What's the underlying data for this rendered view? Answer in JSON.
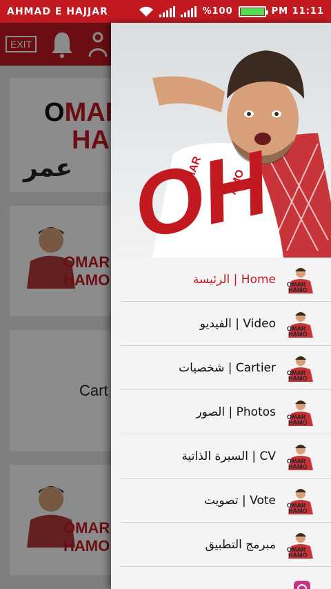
{
  "status_bar": {
    "carrier": "AHMAD E HAJJAR",
    "battery": "%100",
    "battery_level": 1.0,
    "time": "PM 11:11"
  },
  "background_app": {
    "exit_label": "EXIT",
    "logo_latin_line1_dark": "O",
    "logo_latin_line1_red": "MAR",
    "logo_latin_line2": "HA",
    "logo_arabic": "عمر حمو",
    "card_name_line1": "OMAR",
    "card_name_line2": "HAMO",
    "card_partial_text": "Cart"
  },
  "drawer": {
    "hero_logo": "OH",
    "hero_logo_sub1": "MAR",
    "hero_logo_sub2": "AMO",
    "menu_items": [
      {
        "label": "الرئيسة | Home",
        "icon": "omar-hamo-thumb-icon",
        "active": true
      },
      {
        "label": "الفيديو | Video",
        "icon": "omar-hamo-thumb-icon",
        "active": false
      },
      {
        "label": "شخصيات | Cartier",
        "icon": "omar-hamo-thumb-icon",
        "active": false
      },
      {
        "label": "الصور | Photos",
        "icon": "omar-hamo-thumb-icon",
        "active": false
      },
      {
        "label": "السيرة الذاتية | CV",
        "icon": "omar-hamo-thumb-icon",
        "active": false
      },
      {
        "label": "تصويت | Vote",
        "icon": "omar-hamo-thumb-icon",
        "active": false
      },
      {
        "label": "مبرمج التطبيق",
        "icon": "omar-hamo-thumb-icon",
        "active": false
      },
      {
        "label": "",
        "icon": "instagram-icon",
        "active": false
      }
    ],
    "thumb_text_line1": "OMAR",
    "thumb_text_line2": "HAMO"
  },
  "colors": {
    "brand_red": "#c31a22",
    "active_text": "#c31a22",
    "battery_green": "#52e052"
  }
}
